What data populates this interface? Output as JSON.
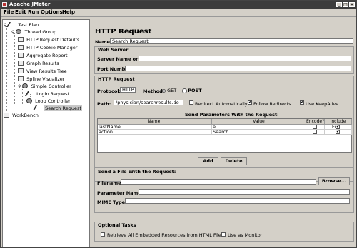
{
  "window": {
    "title": "Apache JMeter"
  },
  "menu": {
    "file": "File",
    "edit": "Edit",
    "run": "Run",
    "options": "Options",
    "help": "Help"
  },
  "tree": {
    "test_plan": "Test Plan",
    "thread_group": "Thread Group",
    "items": [
      "HTTP Request Defaults",
      "HTTP Cookie Manager",
      "Aggregate Report",
      "Graph Results",
      "View Results Tree",
      "Spline Visualizer"
    ],
    "simple_controller": "Simple Controller",
    "login_request": "Login Request",
    "loop_controller": "Loop Controller",
    "search_request": "Search Request",
    "workbench": "WorkBench"
  },
  "form": {
    "heading": "HTTP Request",
    "name_label": "Name:",
    "name_value": "Search Request",
    "web_server": "Web Server",
    "server_label": "Server Name or IP:",
    "server_value": "",
    "port_label": "Port Number:",
    "port_value": "",
    "http_request": "HTTP Request",
    "protocol_label": "Protocol:",
    "protocol_value": "HTTP",
    "method_label": "Method:",
    "get": "GET",
    "post": "POST",
    "path_label": "Path:",
    "path_value": "/physician/searchresults.do",
    "redirect_auto": "Redirect Automatically",
    "follow_redirects": "Follow Redirects",
    "keepalive": "Use KeepAlive",
    "params_title": "Send Parameters With the Request:",
    "columns": [
      "Name:",
      "Value",
      "Encode?",
      "Include Equ..."
    ],
    "rows": [
      {
        "name": "lastName",
        "value": "e"
      },
      {
        "name": "action",
        "value": "Search"
      }
    ],
    "add": "Add",
    "delete": "Delete",
    "file_section": "Send a File With the Request:",
    "filename_label": "Filename:",
    "browse": "Browse...",
    "param_name_label": "Parameter Name:",
    "mime_label": "MIME Type:",
    "optional_tasks": "Optional Tasks",
    "retrieve": "Retrieve All Embedded Resources from HTML Files",
    "monitor": "Use as Monitor"
  }
}
